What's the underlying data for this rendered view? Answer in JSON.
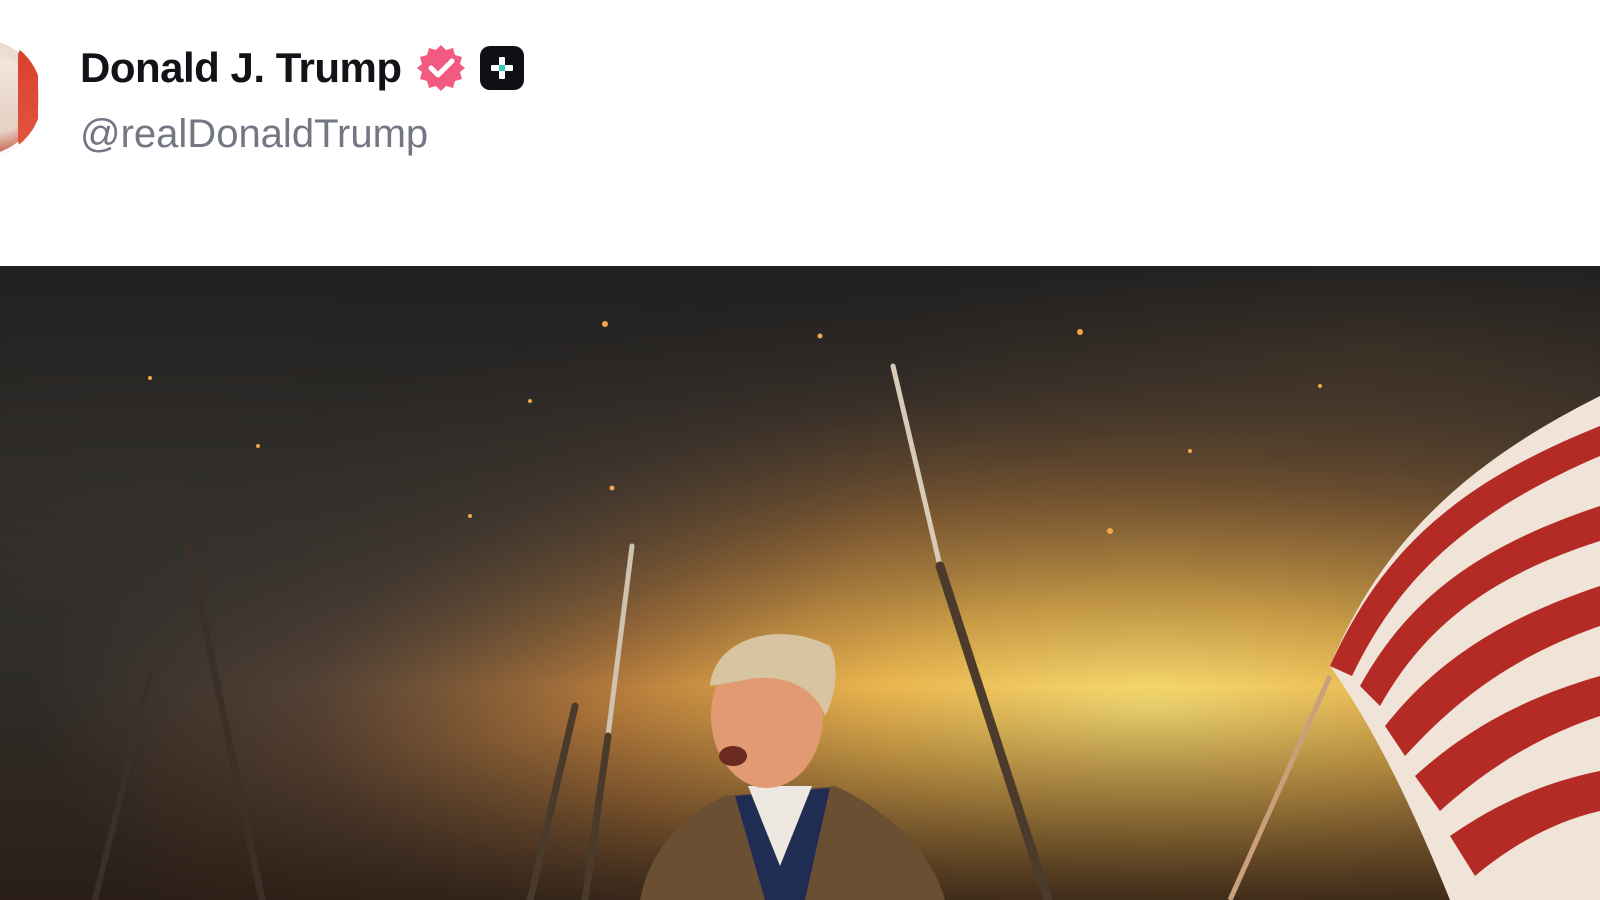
{
  "post": {
    "author": {
      "display_name": "Donald J. Trump",
      "handle": "@realDonaldTrump",
      "avatar_icon": "profile-avatar",
      "verified_icon": "verified-badge-icon",
      "verified_color": "#f25a82",
      "plus_icon": "plus-badge-icon",
      "plus_color": "#0f1015",
      "plus_accent": "#36c7b6"
    },
    "media": {
      "type": "image",
      "description_icon": "battle-scene-image"
    }
  },
  "colors": {
    "name_text": "#111318",
    "handle_text": "#737683",
    "background": "#ffffff"
  }
}
